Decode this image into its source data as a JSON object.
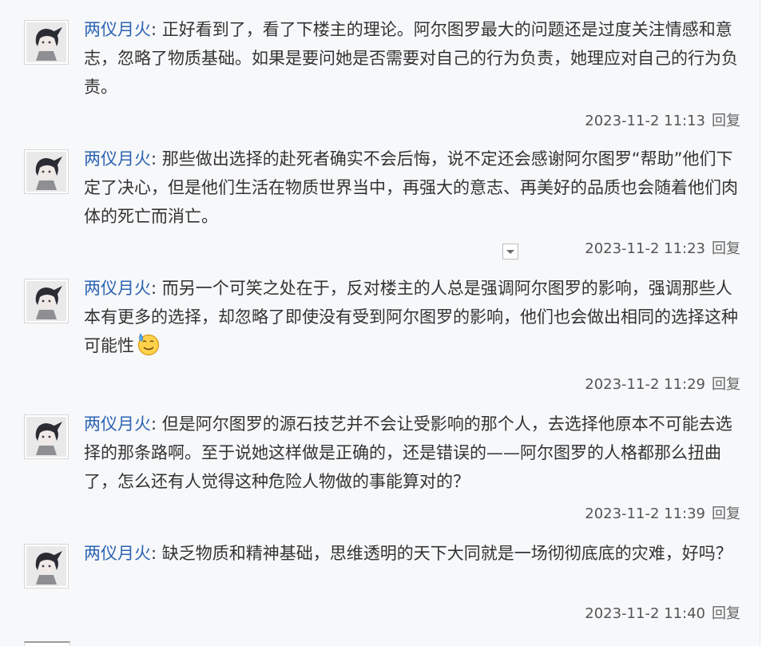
{
  "replies": [
    {
      "username": "两仪月火",
      "text": "正好看到了，看了下楼主的理论。阿尔图罗最大的问题还是过度关注情感和意志，忽略了物质基础。如果是要问她是否需要对自己的行为负责，她理应对自己的行为负责。",
      "timestamp": "2023-11-2 11:13",
      "reply_label": "回复"
    },
    {
      "username": "两仪月火",
      "text": "那些做出选择的赴死者确实不会后悔，说不定还会感谢阿尔图罗“帮助”他们下定了决心，但是他们生活在物质世界当中，再强大的意志、再美好的品质也会随着他们肉体的死亡而消亡。",
      "timestamp": "2023-11-2 11:23",
      "reply_label": "回复"
    },
    {
      "username": "两仪月火",
      "text": "而另一个可笑之处在于，反对楼主的人总是强调阿尔图罗的影响，强调那些人本有更多的选择，却忽略了即使没有受到阿尔图罗的影响，他们也会做出相同的选择这种可能性",
      "emoji": "sweat-smile-emoji",
      "timestamp": "2023-11-2 11:29",
      "reply_label": "回复"
    },
    {
      "username": "两仪月火",
      "text": "但是阿尔图罗的源石技艺并不会让受影响的那个人，去选择他原本不可能去选择的那条路啊。至于说她这样做是正确的，还是错误的——阿尔图罗的人格都那么扭曲了，怎么还有人觉得这种危险人物做的事能算对的？",
      "timestamp": "2023-11-2 11:39",
      "reply_label": "回复"
    },
    {
      "username": "两仪月火",
      "text": "缺乏物质和精神基础，思维透明的天下大同就是一场彻彻底底的灾难，好吗？",
      "timestamp": "2023-11-2 11:40",
      "reply_label": "回复"
    }
  ],
  "separator": ": ",
  "icons": {
    "avatar": "user-avatar-anime",
    "collapse": "collapse-arrow-icon"
  },
  "colors": {
    "username": "#2d64b3",
    "panel_bg": "#f7f8fa",
    "text": "#333333",
    "meta": "#555555"
  }
}
